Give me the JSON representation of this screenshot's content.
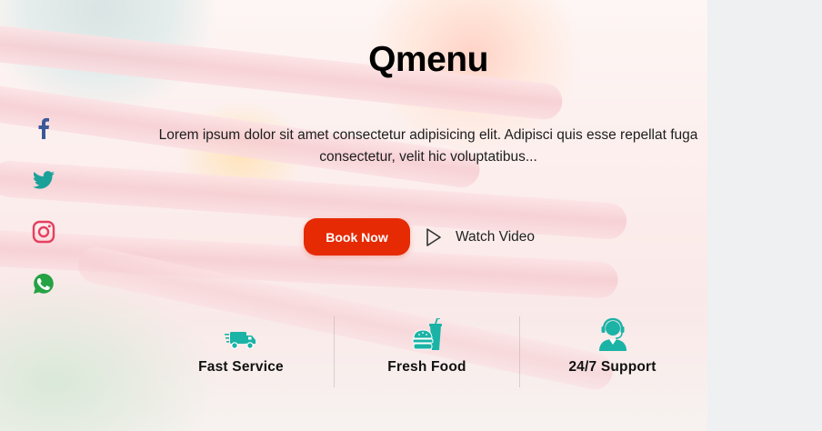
{
  "hero": {
    "title": "Qmenu",
    "description": "Lorem ipsum dolor sit amet consectetur adipisicing elit. Adipisci quis esse repellat fuga consectetur, velit hic voluptatibus...",
    "book_button": "Book Now",
    "watch_video": "Watch Video"
  },
  "social": [
    {
      "name": "facebook-icon",
      "color": "#3b5998"
    },
    {
      "name": "twitter-icon",
      "color": "#1aa19a"
    },
    {
      "name": "instagram-icon",
      "color": "#e4405f"
    },
    {
      "name": "whatsapp-icon",
      "color": "#25a244"
    }
  ],
  "features": [
    {
      "icon": "delivery-truck-icon",
      "label": "Fast Service"
    },
    {
      "icon": "burger-drink-icon",
      "label": "Fresh Food"
    },
    {
      "icon": "support-agent-icon",
      "label": "24/7 Support"
    }
  ],
  "colors": {
    "accent": "#e52a04",
    "feature_icon": "#1ab3a6"
  }
}
